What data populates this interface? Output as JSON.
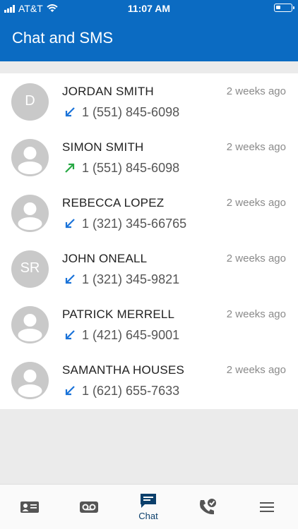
{
  "status_bar": {
    "carrier": "AT&T",
    "time": "11:07 AM",
    "battery_level": 0.3
  },
  "header": {
    "title": "Chat and SMS"
  },
  "contacts": [
    {
      "name": "JORDAN SMITH",
      "number": "1 (551) 845-6098",
      "time": "2 weeks ago",
      "direction": "incoming",
      "avatar_initials": "D"
    },
    {
      "name": "SIMON SMITH",
      "number": "1 (551) 845-6098",
      "time": "2 weeks ago",
      "direction": "outgoing",
      "avatar_initials": ""
    },
    {
      "name": "REBECCA LOPEZ",
      "number": "1 (321) 345-66765",
      "time": "2 weeks ago",
      "direction": "incoming",
      "avatar_initials": ""
    },
    {
      "name": "JOHN ONEALL",
      "number": "1 (321) 345-9821",
      "time": "2 weeks ago",
      "direction": "incoming",
      "avatar_initials": "SR"
    },
    {
      "name": "PATRICK MERRELL",
      "number": "1 (421) 645-9001",
      "time": "2 weeks ago",
      "direction": "incoming",
      "avatar_initials": ""
    },
    {
      "name": "SAMANTHA HOUSES",
      "number": "1 (621) 655-7633",
      "time": "2 weeks ago",
      "direction": "incoming",
      "avatar_initials": ""
    }
  ],
  "tabbar": {
    "tabs": [
      {
        "icon": "contacts-card-icon",
        "label": ""
      },
      {
        "icon": "voicemail-icon",
        "label": ""
      },
      {
        "icon": "chat-icon",
        "label": "Chat",
        "active": true
      },
      {
        "icon": "phone-check-icon",
        "label": ""
      },
      {
        "icon": "menu-icon",
        "label": ""
      }
    ]
  },
  "colors": {
    "header": "#0b6bc2",
    "incoming_arrow": "#1a73d9",
    "outgoing_arrow": "#27a844",
    "tab_icon": "#555555",
    "tab_active": "#0b3f6b",
    "avatar": "#c9c9c9"
  }
}
